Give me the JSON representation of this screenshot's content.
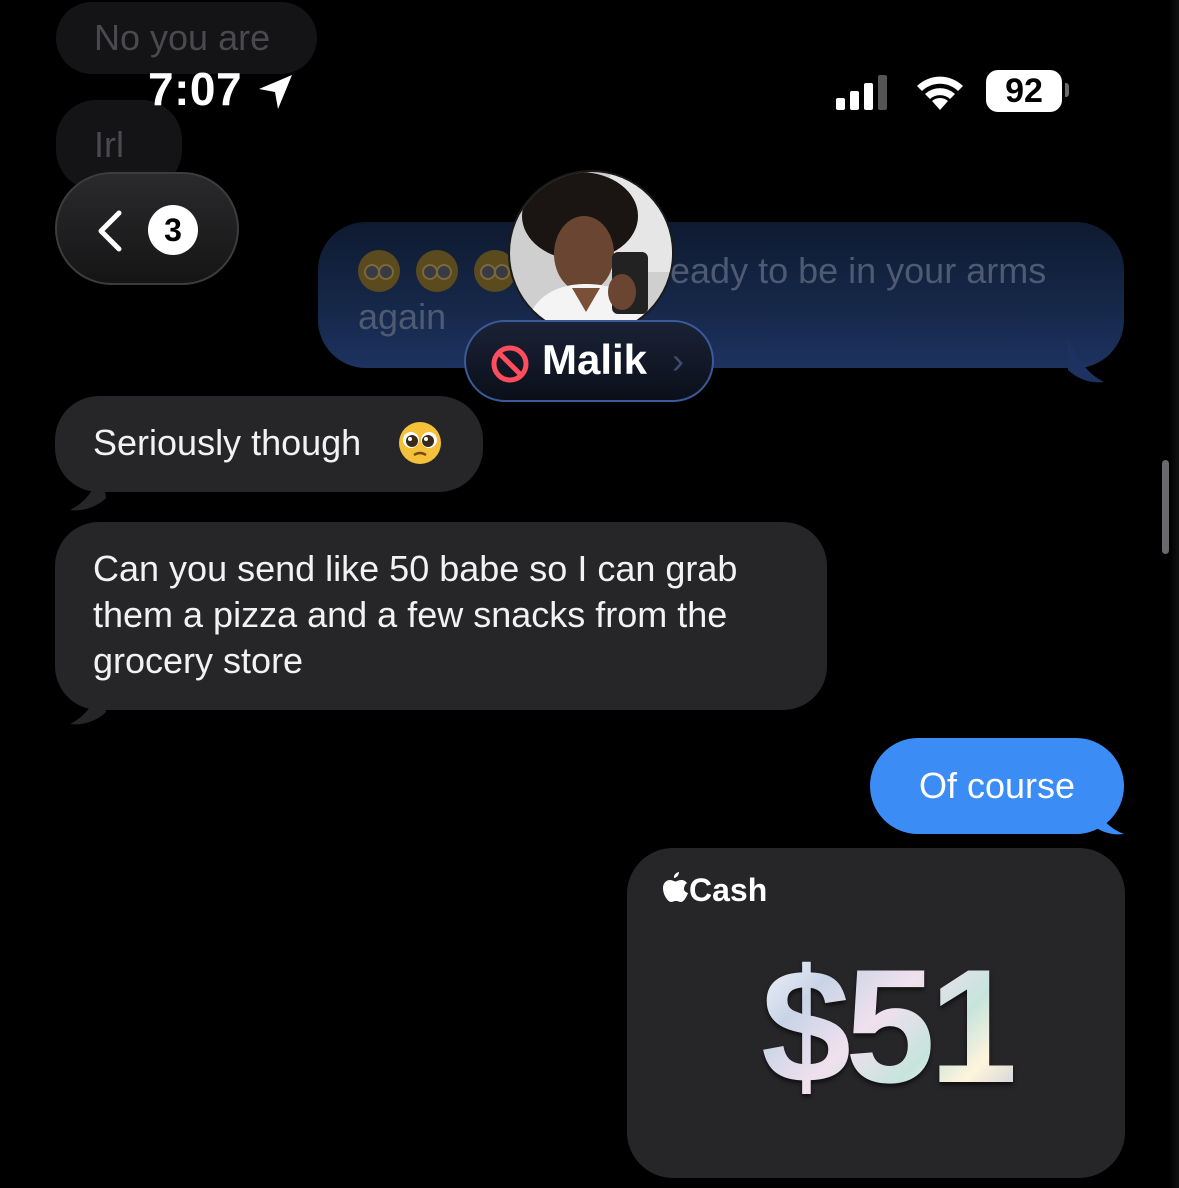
{
  "status_bar": {
    "time": "7:07",
    "battery": "92"
  },
  "faded_messages": [
    "No you are",
    "Irl"
  ],
  "header": {
    "back_badge_count": "3",
    "contact_name": "Malik"
  },
  "dimmed_sent_message": {
    "line1": "eady to be in your arms",
    "line2": "again"
  },
  "messages": [
    {
      "direction": "received",
      "text": "Seriously though"
    },
    {
      "direction": "received",
      "text": "Can you send like 50 babe so I can grab them a pizza and a few snacks from the grocery store"
    },
    {
      "direction": "sent",
      "text": "Of course"
    }
  ],
  "apple_cash": {
    "label": "Cash",
    "amount": "$51"
  },
  "colors": {
    "sent_bubble": "#3b8cf4",
    "received_bubble": "#262628",
    "background": "#000000"
  }
}
